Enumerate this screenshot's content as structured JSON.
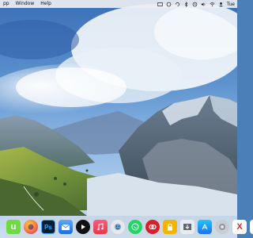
{
  "menubar": {
    "items": [
      "pp",
      "Window",
      "Help"
    ],
    "clock": "Tue"
  },
  "dock": {
    "icons": [
      {
        "name": "upwork-icon",
        "glyph": "u",
        "color": "#6fda44"
      },
      {
        "name": "firefox-icon",
        "glyph": "",
        "color": "#ff7139"
      },
      {
        "name": "photoshop-icon",
        "glyph": "Ps",
        "color": "#001e36"
      },
      {
        "name": "mail-icon",
        "glyph": "",
        "color": "#2f7fe8"
      },
      {
        "name": "apple-tv-icon",
        "glyph": "",
        "color": "#111111"
      },
      {
        "name": "music-icon",
        "glyph": "",
        "color": "#f54a60"
      },
      {
        "name": "webcam-icon",
        "glyph": "",
        "color": "#e8e8ea"
      },
      {
        "name": "whatsapp-icon",
        "glyph": "",
        "color": "#25d366"
      },
      {
        "name": "creative-cloud-icon",
        "glyph": "",
        "color": "#da1f26"
      },
      {
        "name": "lock-icon",
        "glyph": "",
        "color": "#f4b400"
      },
      {
        "name": "download-icon",
        "glyph": "",
        "color": "#5d6675"
      },
      {
        "name": "app-store-icon",
        "glyph": "",
        "color": "#1e8cf5"
      },
      {
        "name": "preview-icon",
        "glyph": "",
        "color": "#8d949c"
      },
      {
        "name": "close-app-icon",
        "glyph": "X",
        "color": "#d92a2a"
      },
      {
        "name": "photos-icon",
        "glyph": "",
        "color": "#ffffff"
      }
    ]
  }
}
